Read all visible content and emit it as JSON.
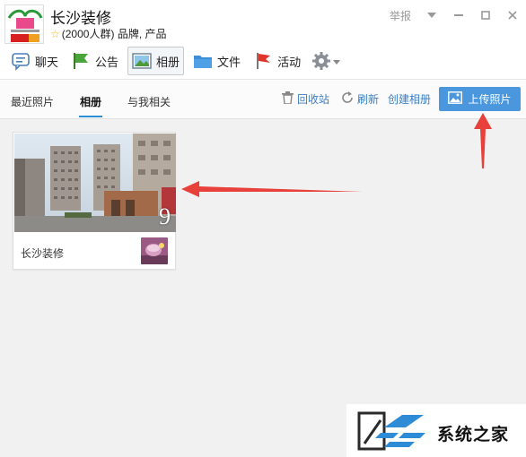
{
  "group": {
    "name": "长沙装修",
    "members": "(2000人群)",
    "tags": "品牌, 产品"
  },
  "window": {
    "report_label": "举报"
  },
  "tabs": [
    {
      "label": "聊天",
      "icon": "chat-icon"
    },
    {
      "label": "公告",
      "icon": "announcement-flag-icon"
    },
    {
      "label": "相册",
      "icon": "photo-album-icon",
      "active": true
    },
    {
      "label": "文件",
      "icon": "folder-icon"
    },
    {
      "label": "活动",
      "icon": "activity-flag-icon"
    }
  ],
  "subtabs": [
    {
      "label": "最近照片"
    },
    {
      "label": "相册",
      "active": true
    },
    {
      "label": "与我相关"
    }
  ],
  "actions": {
    "recycle_bin": "回收站",
    "refresh": "刷新",
    "create_album": "创建相册",
    "upload": "上传照片"
  },
  "albums": [
    {
      "title": "长沙装修",
      "count": "9"
    }
  ],
  "watermark": {
    "text": "系统之家"
  },
  "colors": {
    "accent": "#4a97dd",
    "link": "#3b7fc4",
    "annotation_arrow": "#e8403a",
    "background": "#f2f1f1"
  }
}
